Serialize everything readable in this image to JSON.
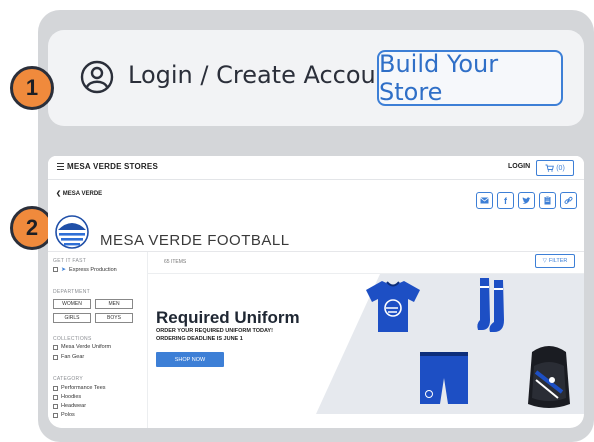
{
  "steps": [
    "1",
    "2"
  ],
  "account": {
    "login_label": "Login / Create Account",
    "build_label": "Build Your Store"
  },
  "site": {
    "store_name": "MESA VERDE STORES",
    "login": "LOGIN",
    "cart_count": "(0)",
    "back_label": "MESA VERDE",
    "team_title": "MESA VERDE FOOTBALL",
    "share_icons": [
      "email-icon",
      "facebook-icon",
      "twitter-icon",
      "clipboard-icon",
      "link-icon"
    ]
  },
  "sidebar": {
    "get_it_fast": "GET IT FAST",
    "express": "Express Production",
    "department": "DEPARTMENT",
    "dept_buttons": [
      "WOMEN",
      "MEN",
      "GIRLS",
      "BOYS"
    ],
    "collections": "COLLECTIONS",
    "collection_items": [
      "Mesa Verde Uniform",
      "Fan Gear"
    ],
    "category": "CATEGORY",
    "category_items": [
      "Performance Tees",
      "Hoodies",
      "Headwear",
      "Polos"
    ]
  },
  "content": {
    "items_count": "65 ITEMS",
    "filter": "FILTER"
  },
  "banner": {
    "heading": "Required Uniform",
    "line1": "ORDER YOUR REQUIRED UNIFORM TODAY!",
    "line2": "ORDERING DEADLINE IS JUNE 1",
    "shop_now": "SHOP NOW"
  },
  "colors": {
    "accent": "#3d7fd6",
    "badge": "#f08a3c",
    "panel": "#d4d6d9",
    "jersey": "#1d4fc4"
  }
}
